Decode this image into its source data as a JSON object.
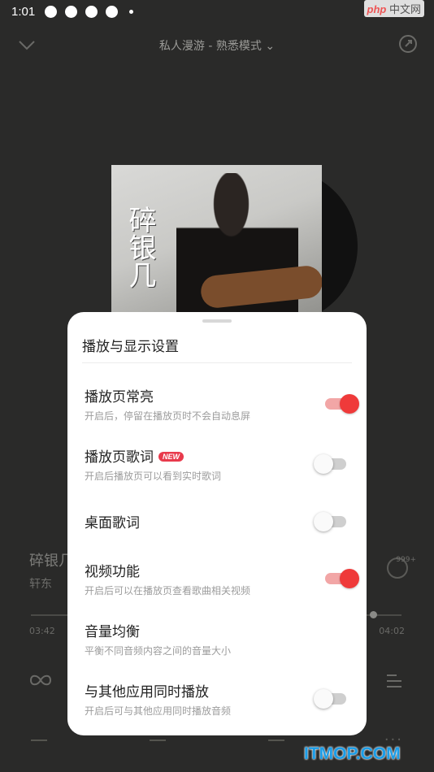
{
  "status_bar": {
    "time": "1:01"
  },
  "watermark": {
    "text": "php",
    "suffix": "中文网"
  },
  "header": {
    "title": "私人漫游 - 熟悉模式 ⌄"
  },
  "album": {
    "cover_text": "碎银几"
  },
  "player": {
    "song_title": "碎银几",
    "artist": "轩东",
    "comment_count": "999+",
    "time_current": "03:42",
    "time_total": "04:02",
    "progress": 0.92
  },
  "settings_sheet": {
    "title": "播放与显示设置",
    "items": [
      {
        "label": "播放页常亮",
        "desc": "开启后，停留在播放页时不会自动息屏",
        "on": true,
        "badge": ""
      },
      {
        "label": "播放页歌词",
        "desc": "开启后播放页可以看到实时歌词",
        "on": false,
        "badge": "NEW"
      },
      {
        "label": "桌面歌词",
        "desc": "",
        "on": false,
        "badge": ""
      },
      {
        "label": "视频功能",
        "desc": "开启后可以在播放页查看歌曲相关视频",
        "on": true,
        "badge": ""
      },
      {
        "label": "音量均衡",
        "desc": "平衡不同音频内容之间的音量大小",
        "on": null,
        "badge": ""
      },
      {
        "label": "与其他应用同时播放",
        "desc": "开启后可与其他应用同时播放音频",
        "on": false,
        "badge": ""
      }
    ]
  },
  "colors": {
    "accent": "#ef3a3a",
    "background": "#2a2a29"
  },
  "brand_watermark": "ITMOP.COM"
}
